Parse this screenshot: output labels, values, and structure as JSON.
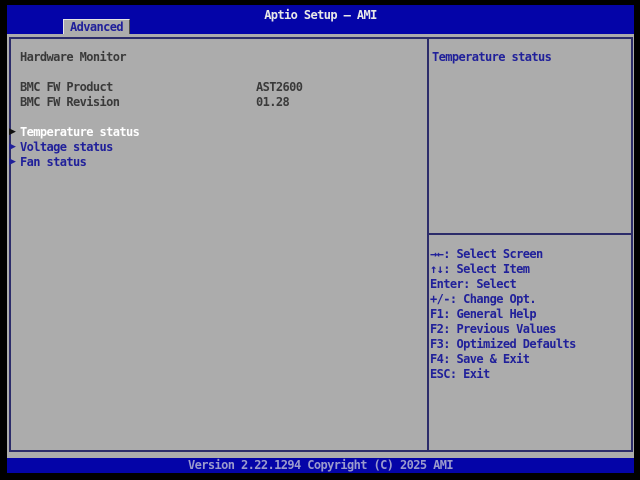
{
  "header": {
    "title": "Aptio Setup – AMI",
    "tab": "Advanced"
  },
  "icons": {
    "submenu_arrow": "▶"
  },
  "left_panel": {
    "section_title": "Hardware Monitor",
    "info_rows": [
      {
        "label": "BMC FW Product",
        "value": "AST2600"
      },
      {
        "label": "BMC FW Revision",
        "value": "01.28"
      }
    ],
    "menu_items": [
      {
        "label": "Temperature status",
        "selected": true
      },
      {
        "label": "Voltage status",
        "selected": false
      },
      {
        "label": "Fan status",
        "selected": false
      }
    ]
  },
  "help_panel": {
    "description": "Temperature status",
    "hotkeys": [
      "→←: Select Screen",
      "↑↓: Select Item",
      "Enter: Select",
      "+/-: Change Opt.",
      "F1: General Help",
      "F2: Previous Values",
      "F3: Optimized Defaults",
      "F4: Save & Exit",
      "ESC: Exit"
    ]
  },
  "footer": {
    "version_text": "Version 2.22.1294 Copyright (C) 2025 AMI"
  },
  "colors": {
    "ami_blue": "#0404a8",
    "panel_gray": "#acacac",
    "navy_text": "#20209a",
    "info_text": "#3a3a3a",
    "selected_text": "#ffffff",
    "version_text": "#9b9bcd"
  }
}
